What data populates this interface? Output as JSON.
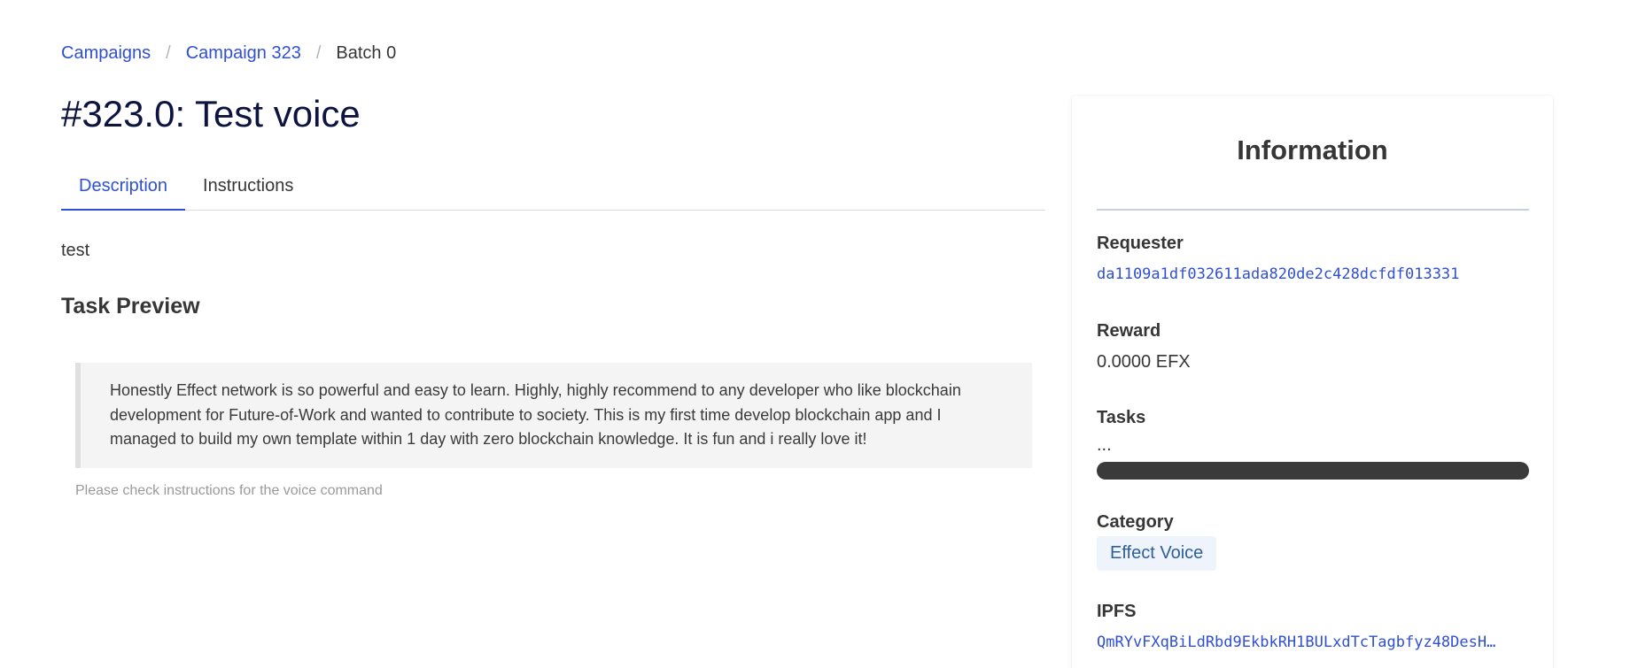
{
  "breadcrumb": {
    "items": [
      "Campaigns",
      "Campaign 323",
      "Batch 0"
    ],
    "separator": "/"
  },
  "page": {
    "title": "#323.0: Test voice"
  },
  "tabs": [
    {
      "label": "Description",
      "active": true
    },
    {
      "label": "Instructions",
      "active": false
    }
  ],
  "description": {
    "text": "test",
    "preview_title": "Task Preview",
    "preview_quote": "Honestly Effect network is so powerful and easy to learn. Highly, highly recommend to any developer who like blockchain development for Future-of-Work and wanted to contribute to society. This is my first time develop blockchain app and I managed to build my own template within 1 day with zero blockchain knowledge. It is fun and i really love it!",
    "hint": "Please check instructions for the voice command"
  },
  "info": {
    "title": "Information",
    "requester_label": "Requester",
    "requester_value": "da1109a1df032611ada820de2c428dcfdf013331",
    "reward_label": "Reward",
    "reward_value": "0.0000 EFX",
    "tasks_label": "Tasks",
    "tasks_value": "...",
    "tasks_progress": 0,
    "category_label": "Category",
    "category_value": "Effect Voice",
    "ipfs_label": "IPFS",
    "ipfs_value": "QmRYvFXqBiLdRbd9EkbkRH1BULxdTcTagbfyz48DesH…"
  },
  "colors": {
    "link": "#2f4fd4",
    "title": "#0d1440",
    "progress_track": "#3a3a3a",
    "tag_bg": "#eef3fc",
    "tag_text": "#2d5f9a"
  }
}
